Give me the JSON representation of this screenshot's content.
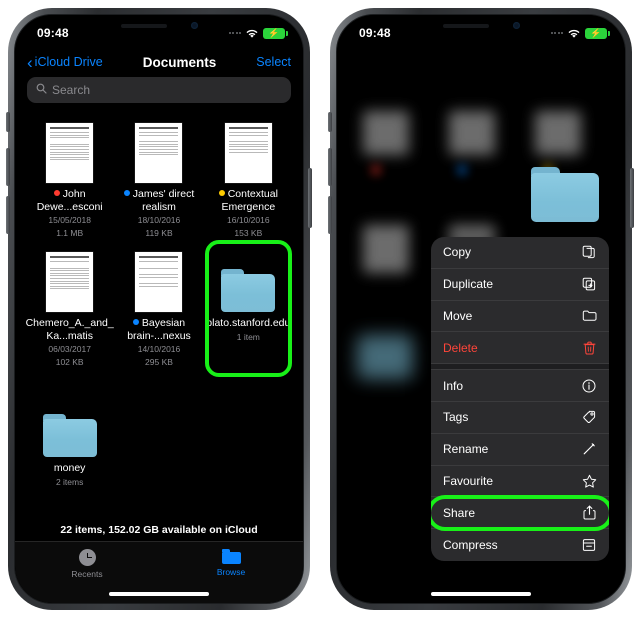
{
  "left_phone": {
    "status_bar": {
      "time": "09:48",
      "wifi_icon": "wifi-icon",
      "battery_icon": "battery-charging-icon"
    },
    "nav": {
      "back_label": "iCloud Drive",
      "title": "Documents",
      "select_label": "Select"
    },
    "search": {
      "placeholder": "Search",
      "icon": "search-icon"
    },
    "files": [
      {
        "name": "John Dewe...esconi",
        "date": "15/05/2018",
        "size": "1.1 MB",
        "tag_color": "#ff3b30",
        "kind": "document"
      },
      {
        "name": "James' direct realism",
        "date": "18/10/2016",
        "size": "119 KB",
        "tag_color": "#0a84ff",
        "kind": "document"
      },
      {
        "name": "Contextual Emergence",
        "date": "16/10/2016",
        "size": "153 KB",
        "tag_color": "#ffcc00",
        "kind": "document"
      },
      {
        "name": "Chemero_A._and_Ka...matis",
        "date": "06/03/2017",
        "size": "102 KB",
        "tag_color": null,
        "kind": "document"
      },
      {
        "name": "Bayesian brain-...nexus",
        "date": "14/10/2016",
        "size": "295 KB",
        "tag_color": "#0a84ff",
        "kind": "document"
      },
      {
        "name": "plato.stanford.edu",
        "date": "",
        "size": "1 item",
        "tag_color": null,
        "kind": "folder",
        "highlighted": true
      },
      {
        "name": "money",
        "date": "",
        "size": "2 items",
        "tag_color": null,
        "kind": "folder"
      }
    ],
    "footer_status": "22 items, 152.02 GB available on iCloud",
    "tabs": [
      {
        "label": "Recents",
        "icon": "clock-icon",
        "active": false
      },
      {
        "label": "Browse",
        "icon": "folder-icon",
        "active": true
      }
    ]
  },
  "right_phone": {
    "status_bar": {
      "time": "09:48",
      "wifi_icon": "wifi-icon",
      "battery_icon": "battery-charging-icon"
    },
    "context_menu": [
      {
        "label": "Copy",
        "icon": "copy-icon",
        "destructive": false
      },
      {
        "label": "Duplicate",
        "icon": "duplicate-icon",
        "destructive": false
      },
      {
        "label": "Move",
        "icon": "folder-move-icon",
        "destructive": false
      },
      {
        "label": "Delete",
        "icon": "trash-icon",
        "destructive": true
      },
      {
        "label": "Info",
        "icon": "info-circle-icon",
        "destructive": false
      },
      {
        "label": "Tags",
        "icon": "tag-icon",
        "destructive": false
      },
      {
        "label": "Rename",
        "icon": "pencil-icon",
        "destructive": false
      },
      {
        "label": "Favourite",
        "icon": "star-icon",
        "destructive": false
      },
      {
        "label": "Share",
        "icon": "share-icon",
        "destructive": false,
        "highlighted": true
      },
      {
        "label": "Compress",
        "icon": "archive-box-icon",
        "destructive": false
      }
    ]
  },
  "highlight_color": "#18f018",
  "accent_color": "#0a84ff",
  "folder_color": "#7cbfd8"
}
